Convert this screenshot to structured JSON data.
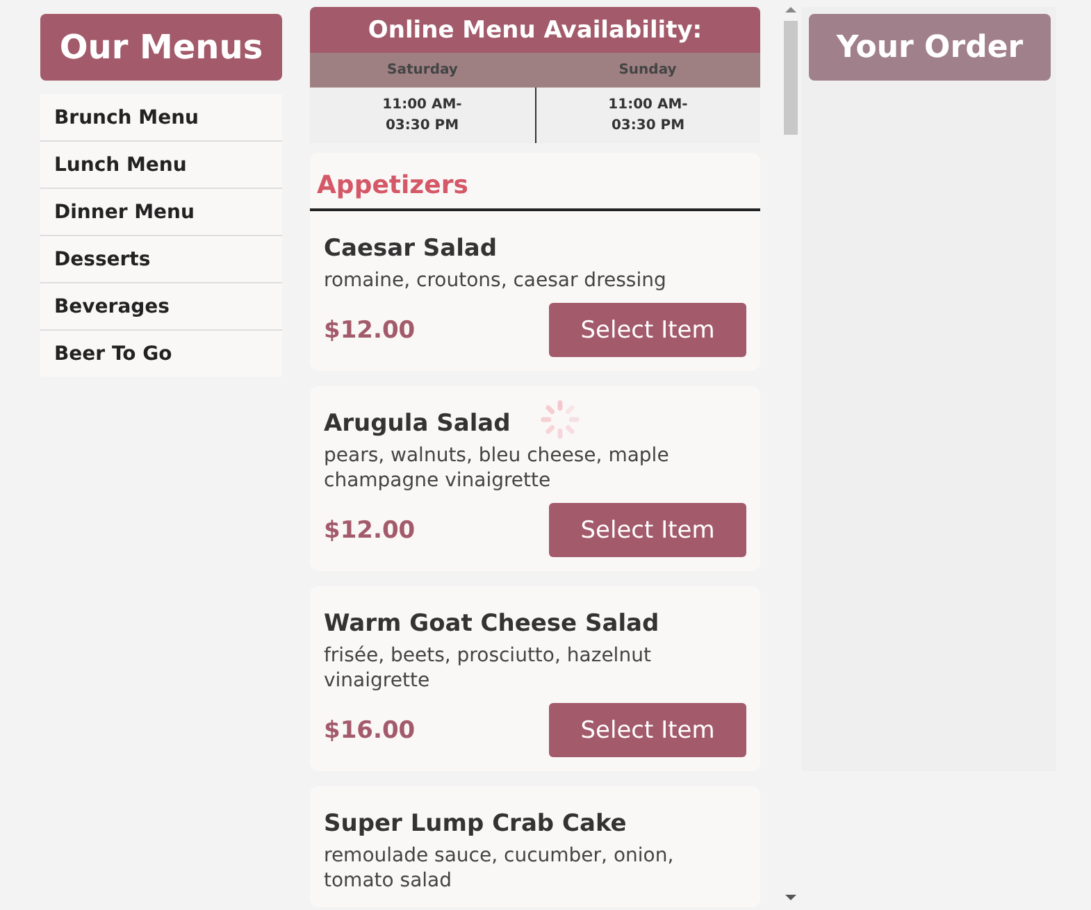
{
  "sidebar": {
    "title": "Our Menus",
    "items": [
      {
        "label": "Brunch Menu"
      },
      {
        "label": "Lunch Menu"
      },
      {
        "label": "Dinner Menu"
      },
      {
        "label": "Desserts"
      },
      {
        "label": "Beverages"
      },
      {
        "label": "Beer To Go"
      }
    ]
  },
  "availability": {
    "title": "Online Menu Availability:",
    "days": [
      {
        "day": "Saturday",
        "hours": "11:00 AM-\n03:30 PM"
      },
      {
        "day": "Sunday",
        "hours": "11:00 AM-\n03:30 PM"
      }
    ]
  },
  "section": {
    "title": "Appetizers",
    "items": [
      {
        "name": "Caesar Salad",
        "description": "romaine, croutons, caesar dressing",
        "price": "$12.00",
        "button": "Select Item"
      },
      {
        "name": "Arugula Salad",
        "description": "pears, walnuts, bleu cheese, maple champagne vinaigrette",
        "price": "$12.00",
        "button": "Select Item"
      },
      {
        "name": "Warm Goat Cheese Salad",
        "description": "frisée, beets, prosciutto, hazelnut vinaigrette",
        "price": "$16.00",
        "button": "Select Item"
      },
      {
        "name": "Super Lump Crab Cake",
        "description": "remoulade sauce, cucumber, onion, tomato salad"
      }
    ]
  },
  "order": {
    "title": "Your Order"
  }
}
